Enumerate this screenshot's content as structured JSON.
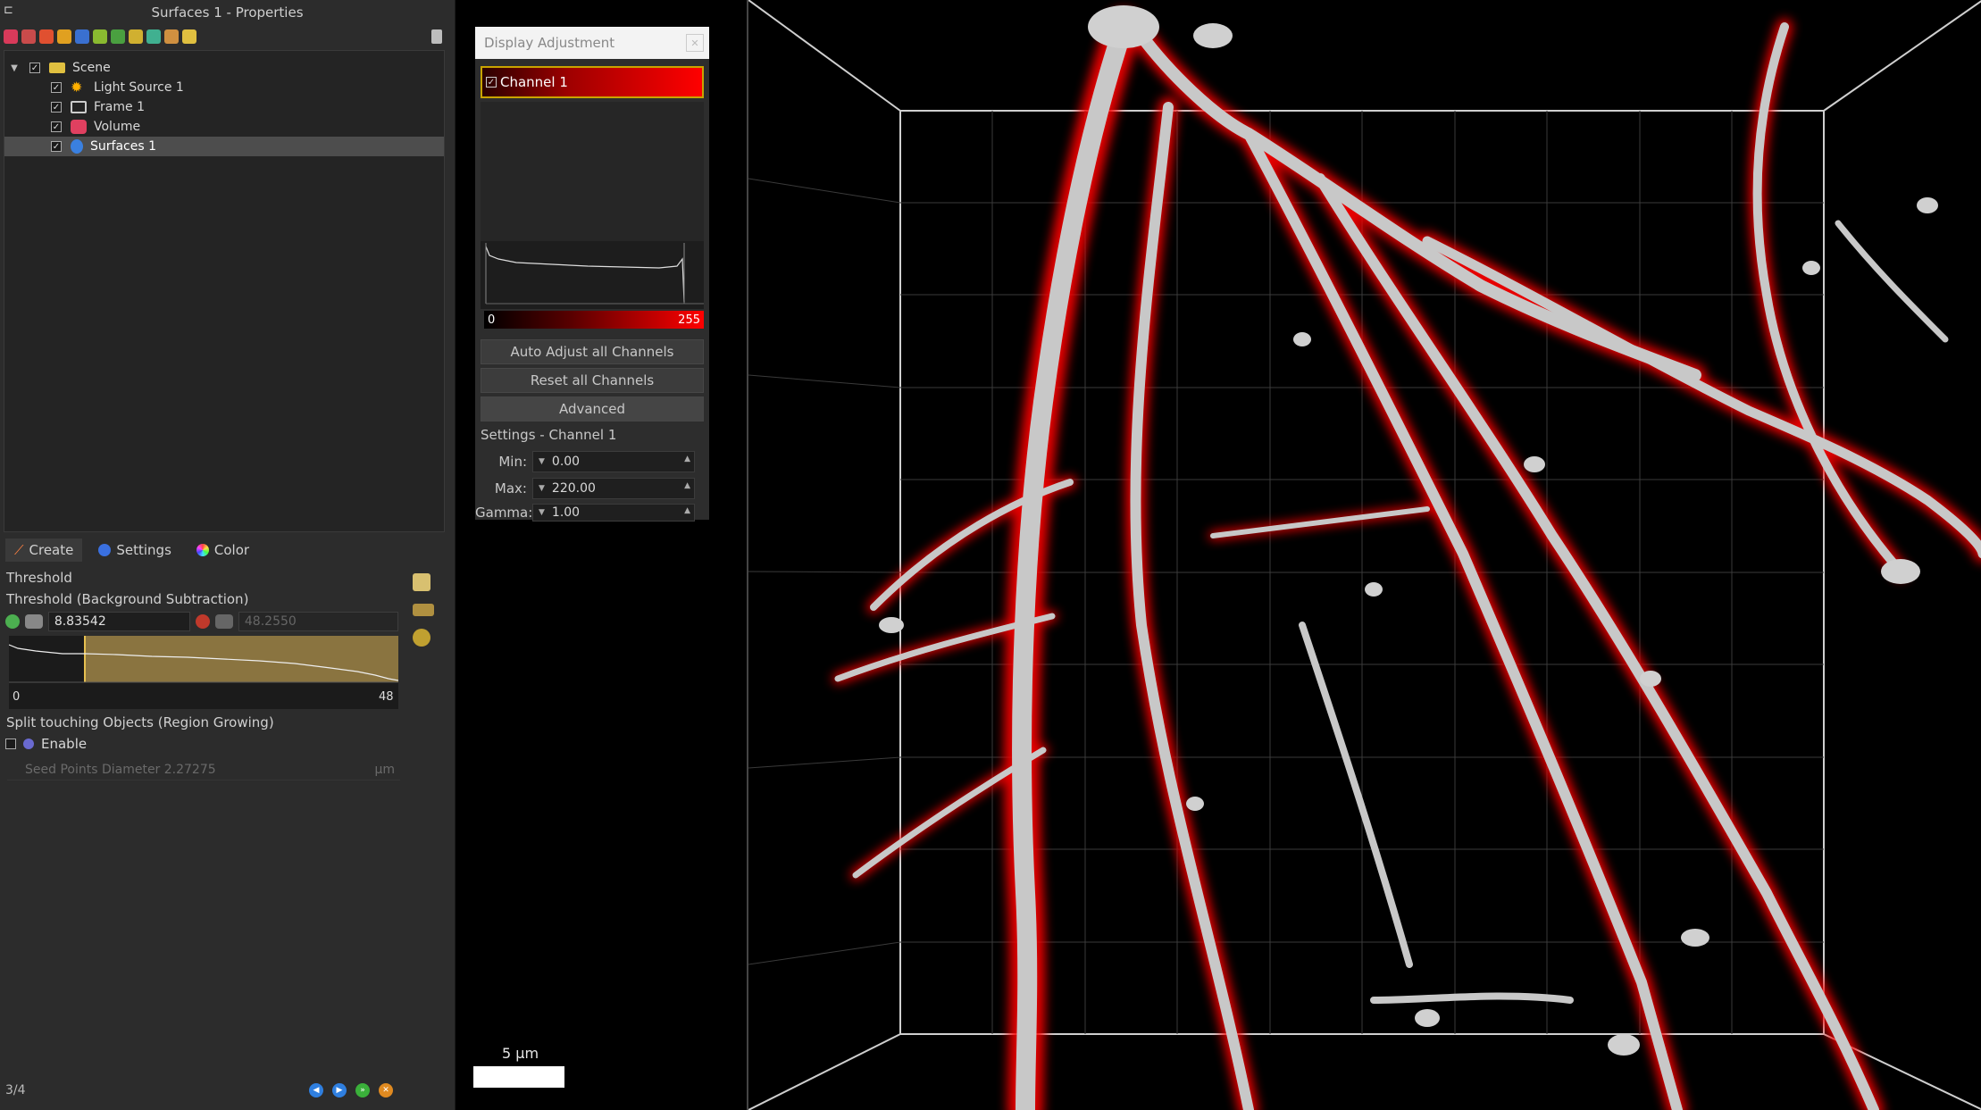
{
  "window": {
    "title": "Surfaces 1 - Properties"
  },
  "toolbar": {
    "icons": [
      "volume-icon",
      "surfaces-icon",
      "filament-icon",
      "spots-icon",
      "cells-icon",
      "cam-icon",
      "leaf-icon",
      "measure-icon",
      "reference-icon",
      "clipping-icon",
      "folder-icon"
    ]
  },
  "tree": {
    "items": [
      {
        "label": "Scene",
        "icon": "folder-icon",
        "checked": true,
        "selected": false,
        "depth": 0
      },
      {
        "label": "Light Source 1",
        "icon": "sun-icon",
        "checked": true,
        "selected": false,
        "depth": 1
      },
      {
        "label": "Frame 1",
        "icon": "frame-icon",
        "checked": true,
        "selected": false,
        "depth": 1
      },
      {
        "label": "Volume",
        "icon": "volume-icon",
        "checked": true,
        "selected": false,
        "depth": 1
      },
      {
        "label": "Surfaces 1",
        "icon": "surfaces-icon",
        "checked": true,
        "selected": true,
        "depth": 1
      }
    ]
  },
  "tabs": [
    {
      "label": "Create",
      "icon": "wand-icon",
      "active": true
    },
    {
      "label": "Settings",
      "icon": "settings-icon",
      "active": false
    },
    {
      "label": "Color",
      "icon": "color-wheel-icon",
      "active": false
    }
  ],
  "create": {
    "threshold_title": "Threshold",
    "threshold_sub": "Threshold (Background Subtraction)",
    "low_value": "8.83542",
    "high_value": "48.2550",
    "hist_min": "0",
    "hist_max": "48",
    "split_label": "Split touching Objects (Region Growing)",
    "enable_label": "Enable",
    "enable_checked": false,
    "seed_label": "Seed Points Diameter 2.27275",
    "seed_unit": "µm"
  },
  "wizard": {
    "step": "3/4"
  },
  "display": {
    "title": "Display Adjustment",
    "channel_label": "Channel 1",
    "channel_color": "#ff0000",
    "range_min": "0",
    "range_max": "255",
    "auto_adjust": "Auto Adjust all Channels",
    "reset": "Reset all Channels",
    "advanced": "Advanced",
    "settings_label": "Settings - Channel 1",
    "min_label": "Min:",
    "min_value": "0.00",
    "max_label": "Max:",
    "max_value": "220.00",
    "gamma_label": "Gamma:",
    "gamma_value": "1.00"
  },
  "scale": {
    "label": "5 µm"
  }
}
